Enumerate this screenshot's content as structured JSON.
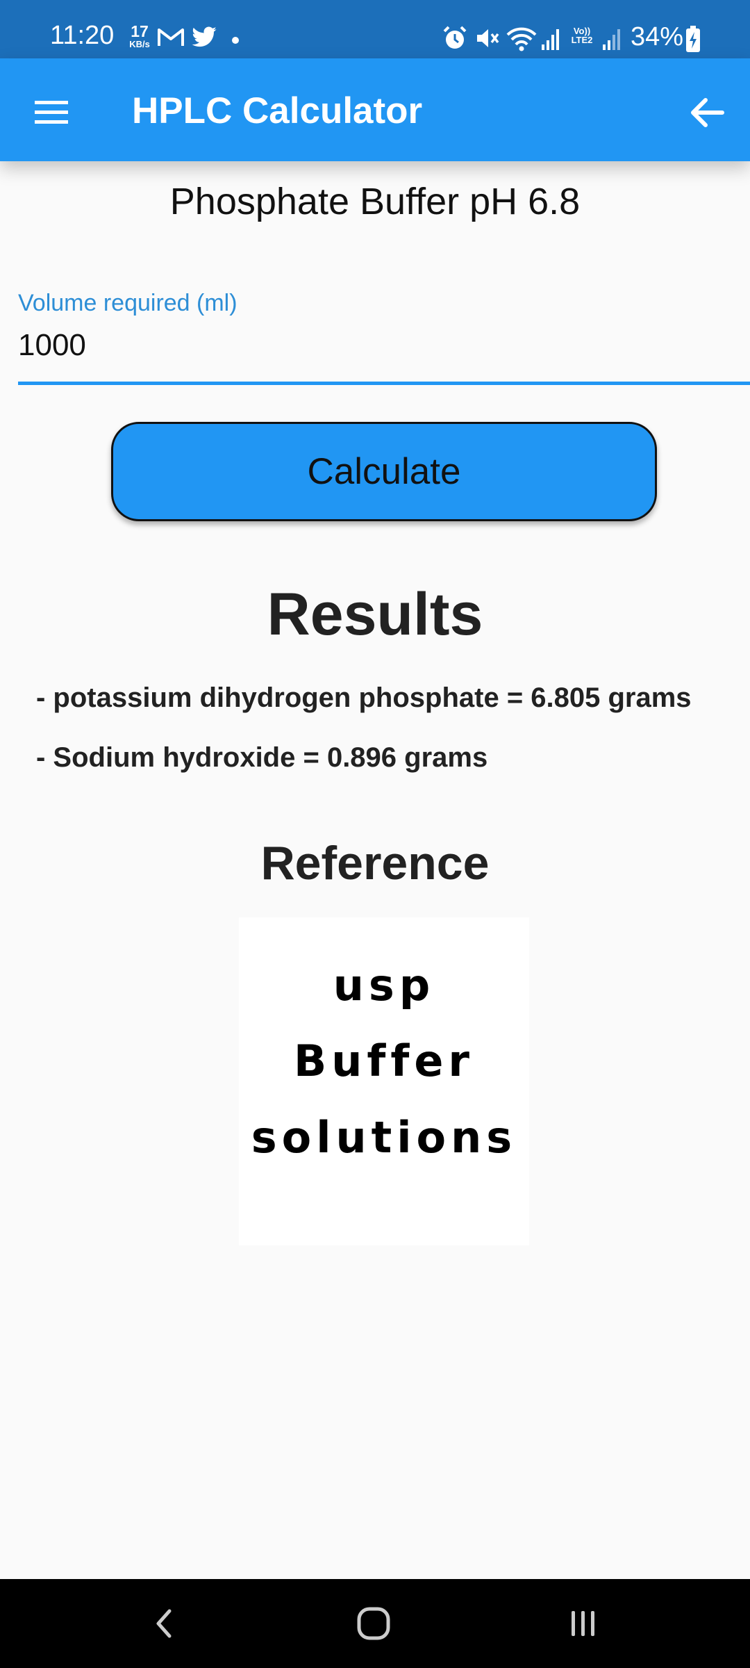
{
  "status_bar": {
    "time": "11:20",
    "net_speed_value": "17",
    "net_speed_unit": "KB/s",
    "lte_top": "Vo))",
    "lte_bottom": "LTE2",
    "battery": "34%",
    "notification_icons": [
      "gmail-icon",
      "twitter-icon",
      "dot-icon"
    ],
    "system_icons": [
      "alarm-icon",
      "mute-icon",
      "wifi-icon",
      "signal-icon",
      "signal-icon",
      "battery-charging-icon"
    ]
  },
  "app_bar": {
    "title": "HPLC Calculator",
    "menu_icon": "menu-icon",
    "back_icon": "arrow-back-icon",
    "color": "#2196f3"
  },
  "page_title": "Phosphate Buffer pH 6.8",
  "volume_field": {
    "label": "Volume required (ml)",
    "value": "1000"
  },
  "calculate_button": {
    "label": "Calculate"
  },
  "results": {
    "heading": "Results",
    "lines": [
      "- potassium dihydrogen phosphate = 6.805 grams",
      "- Sodium hydroxide = 0.896 grams"
    ]
  },
  "reference": {
    "heading": "Reference",
    "image_lines": [
      "usp",
      "Buffer",
      "solutions"
    ]
  },
  "nav_bar": {
    "icons": [
      "nav-back-icon",
      "home-icon",
      "recents-icon"
    ]
  },
  "colors": {
    "status_bar": "#1c6fba",
    "accent": "#2196f3",
    "label": "#2d8ed6",
    "background": "#fafafa"
  }
}
